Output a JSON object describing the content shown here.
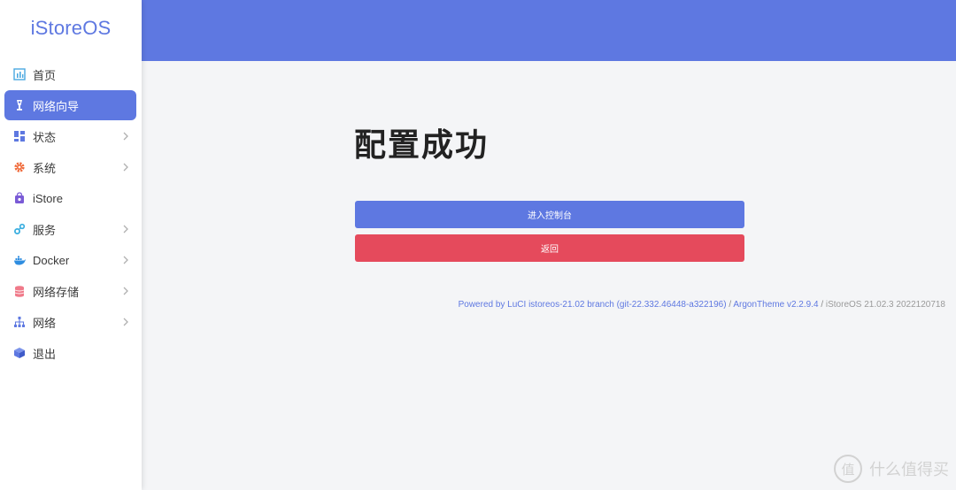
{
  "brand": {
    "title": "iStoreOS"
  },
  "sidebar": {
    "items": [
      {
        "label": "首页",
        "icon": "dashboard-icon"
      },
      {
        "label": "网络向导",
        "icon": "wizard-icon",
        "active": true
      },
      {
        "label": "状态",
        "icon": "status-grid-icon"
      },
      {
        "label": "系统",
        "icon": "gear-icon"
      },
      {
        "label": "iStore",
        "icon": "store-bag-icon"
      },
      {
        "label": "服务",
        "icon": "services-icon"
      },
      {
        "label": "Docker",
        "icon": "docker-icon"
      },
      {
        "label": "网络存储",
        "icon": "storage-icon"
      },
      {
        "label": "网络",
        "icon": "network-tree-icon"
      },
      {
        "label": "退出",
        "icon": "logout-cube-icon"
      }
    ]
  },
  "main": {
    "title": "配置成功",
    "enter_button": "进入控制台",
    "back_button": "返回"
  },
  "footer": {
    "powered": "Powered by LuCI istoreos-21.02 branch (git-22.332.46448-a322196)",
    "sep1": " / ",
    "theme": "ArgonTheme v2.2.9.4",
    "sep2": " / ",
    "version": "iStoreOS 21.02.3 2022120718"
  },
  "watermark": {
    "text": "什么值得买",
    "logo": "值"
  },
  "colors": {
    "accent": "#5e78e1",
    "danger": "#e54a5c",
    "background": "#f4f5f7"
  }
}
